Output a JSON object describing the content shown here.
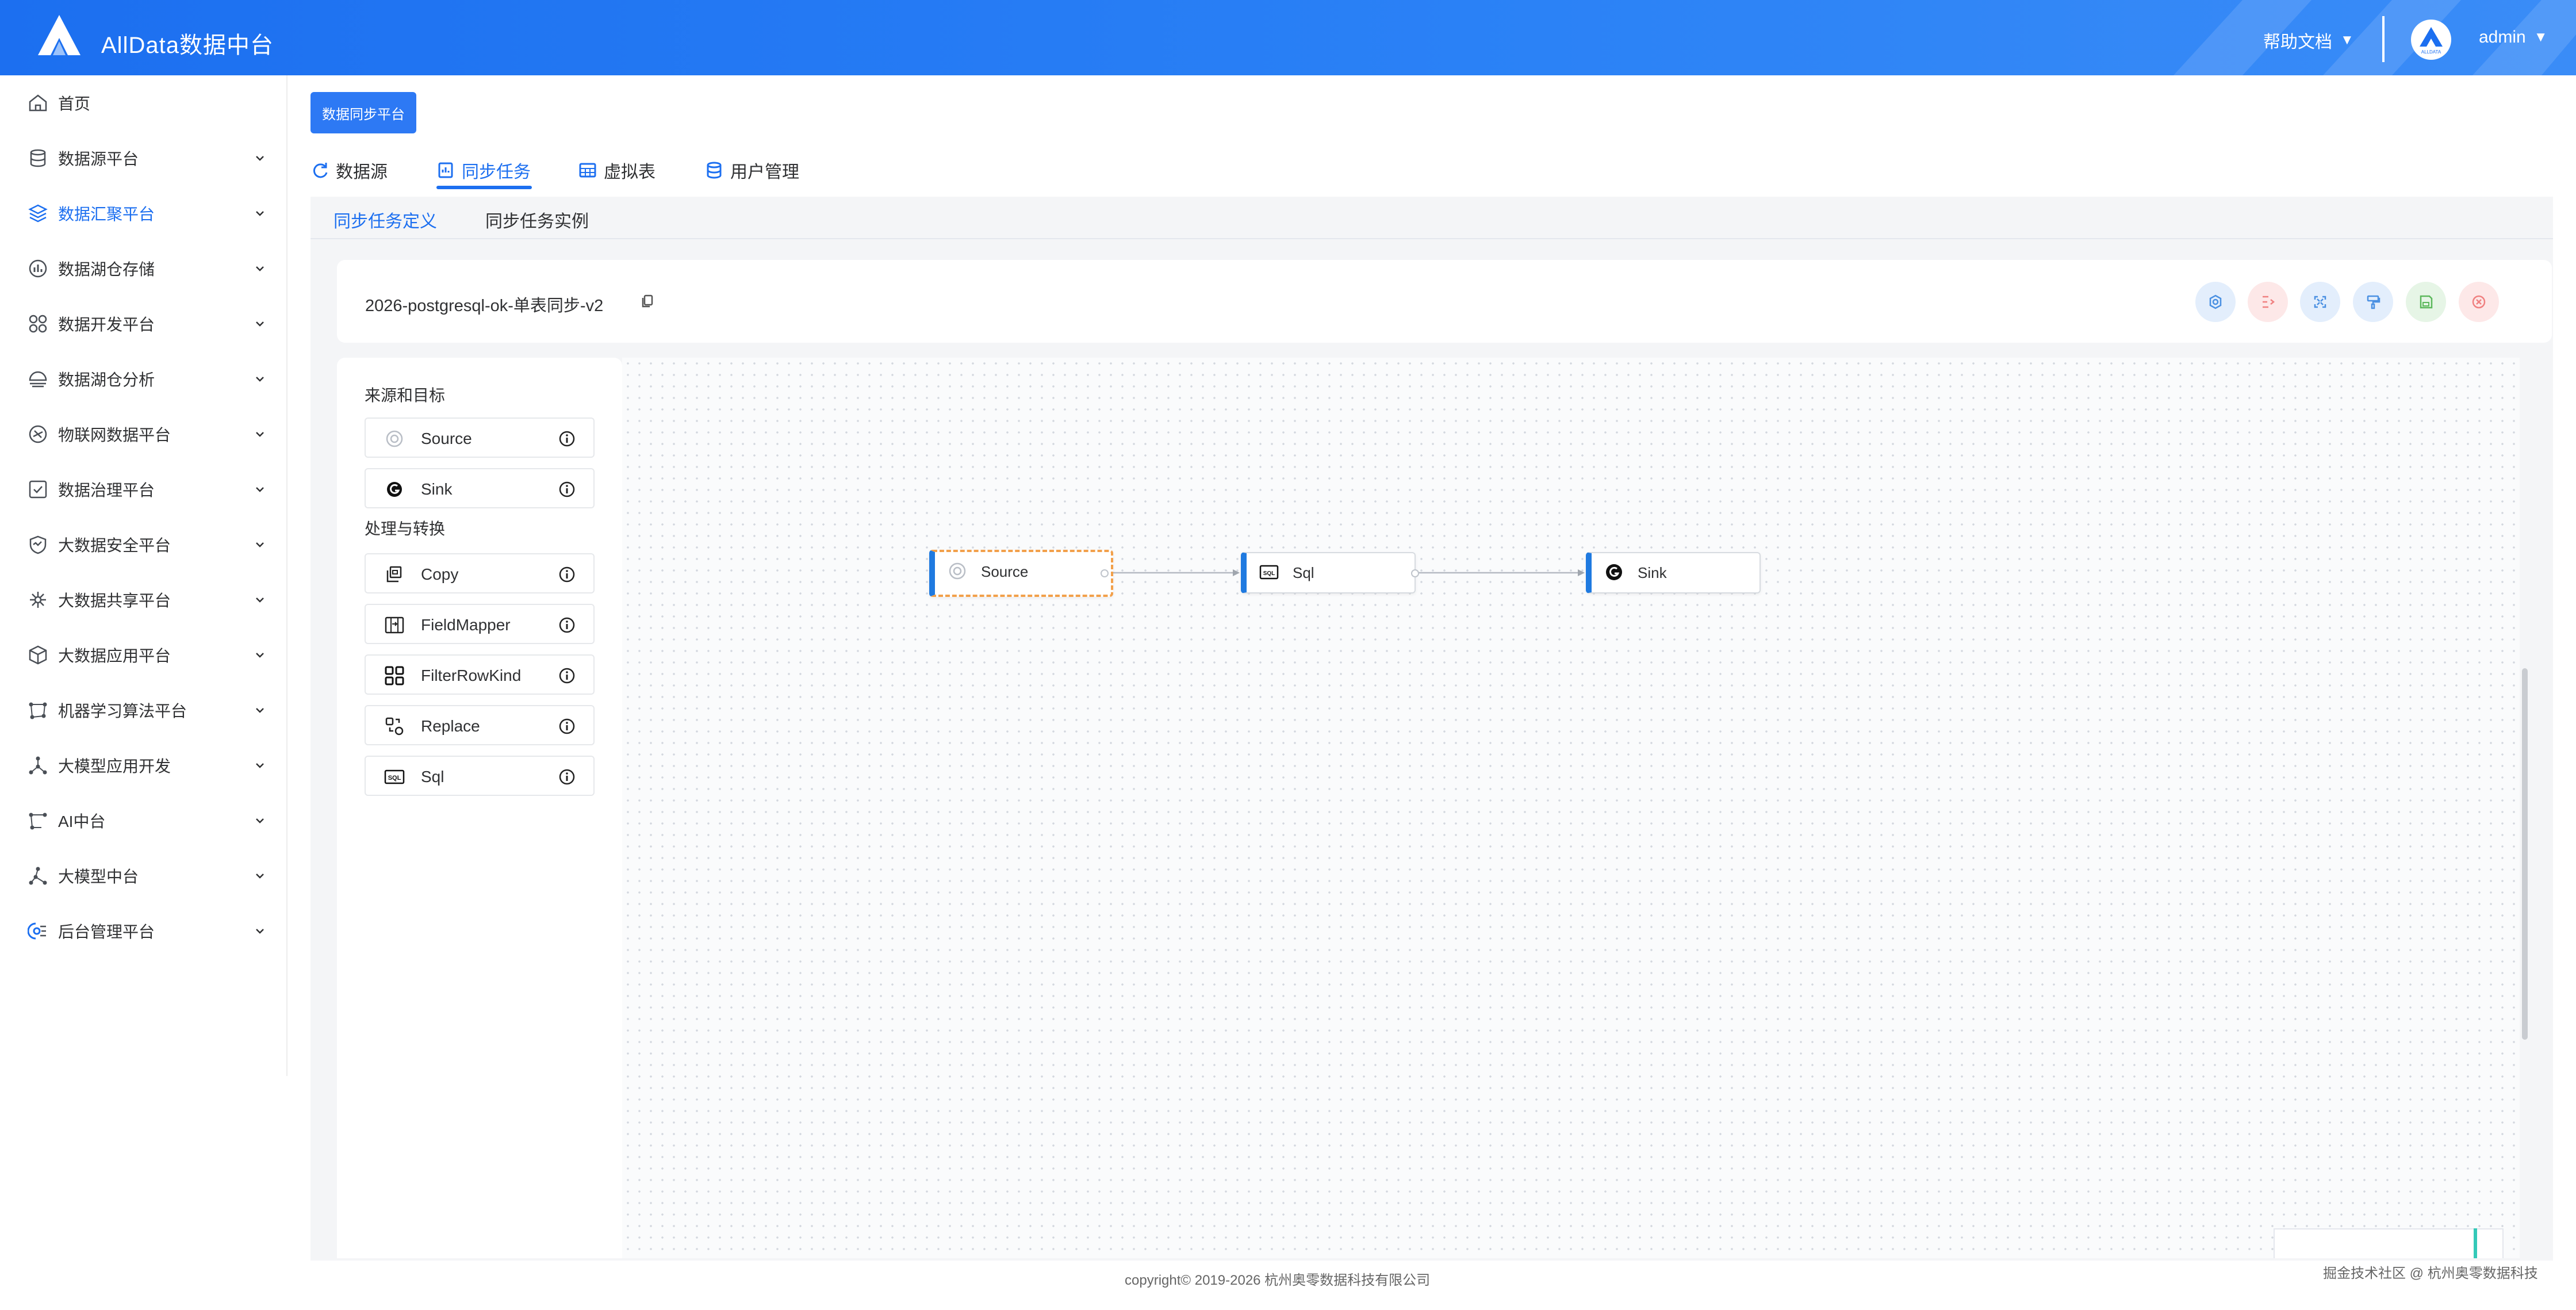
{
  "header": {
    "title": "AllData数据中台",
    "help_label": "帮助文档",
    "user_name": "admin",
    "avatar_text": "ALLDATA",
    "brand_color": "#1c6ff0"
  },
  "sidebar": {
    "items": [
      {
        "label": "首页",
        "icon": "home-icon",
        "has_arrow": false,
        "active": false
      },
      {
        "label": "数据源平台",
        "icon": "database-icon",
        "has_arrow": true,
        "active": false
      },
      {
        "label": "数据汇聚平台",
        "icon": "layers-icon",
        "has_arrow": true,
        "active": true
      },
      {
        "label": "数据湖仓存储",
        "icon": "bar-chart-icon",
        "has_arrow": true,
        "active": false
      },
      {
        "label": "数据开发平台",
        "icon": "grid-icon",
        "has_arrow": true,
        "active": false
      },
      {
        "label": "数据湖仓分析",
        "icon": "analysis-icon",
        "has_arrow": true,
        "active": false
      },
      {
        "label": "物联网数据平台",
        "icon": "link-icon",
        "has_arrow": true,
        "active": false
      },
      {
        "label": "数据治理平台",
        "icon": "checkbox-icon",
        "has_arrow": true,
        "active": false
      },
      {
        "label": "大数据安全平台",
        "icon": "shield-icon",
        "has_arrow": true,
        "active": false
      },
      {
        "label": "大数据共享平台",
        "icon": "share-icon",
        "has_arrow": true,
        "active": false
      },
      {
        "label": "大数据应用平台",
        "icon": "cube-icon",
        "has_arrow": true,
        "active": false
      },
      {
        "label": "机器学习算法平台",
        "icon": "nodes-icon",
        "has_arrow": true,
        "active": false
      },
      {
        "label": "大模型应用开发",
        "icon": "network-icon",
        "has_arrow": true,
        "active": false
      },
      {
        "label": "AI中台",
        "icon": "ai-icon",
        "has_arrow": true,
        "active": false
      },
      {
        "label": "大模型中台",
        "icon": "model-icon",
        "has_arrow": true,
        "active": false
      },
      {
        "label": "后台管理平台",
        "icon": "settings-icon",
        "has_arrow": true,
        "active": false
      }
    ]
  },
  "platform_button": "数据同步平台",
  "tabs": [
    {
      "label": "数据源",
      "icon": "refresh-icon",
      "active": false
    },
    {
      "label": "同步任务",
      "icon": "task-icon",
      "active": true
    },
    {
      "label": "虚拟表",
      "icon": "table-icon",
      "active": false
    },
    {
      "label": "用户管理",
      "icon": "database-icon",
      "active": false
    }
  ],
  "sub_tabs": [
    {
      "label": "同步任务定义",
      "active": true
    },
    {
      "label": "同步任务实例",
      "active": false
    }
  ],
  "task": {
    "name": "2026-postgresql-ok-单表同步-v2"
  },
  "toolbar": [
    {
      "name": "settings-button",
      "icon": "gear-icon",
      "color": "#4a90e2",
      "bg": "#e3eefc"
    },
    {
      "name": "arrange-button",
      "icon": "arrange-icon",
      "color": "#f08080",
      "bg": "#fde8e8"
    },
    {
      "name": "fit-view-button",
      "icon": "fit-icon",
      "color": "#4a90e2",
      "bg": "#e3eefc"
    },
    {
      "name": "format-button",
      "icon": "paint-icon",
      "color": "#4a90e2",
      "bg": "#e3eefc"
    },
    {
      "name": "save-button",
      "icon": "save-icon",
      "color": "#5cb85c",
      "bg": "#e6f5e6"
    },
    {
      "name": "close-button",
      "icon": "close-icon",
      "color": "#f08080",
      "bg": "#fde8e8"
    }
  ],
  "palette": {
    "groups": [
      {
        "title": "来源和目标",
        "items": [
          {
            "label": "Source",
            "icon": "source-icon"
          },
          {
            "label": "Sink",
            "icon": "sink-icon"
          }
        ]
      },
      {
        "title": "处理与转换",
        "items": [
          {
            "label": "Copy",
            "icon": "copy-icon"
          },
          {
            "label": "FieldMapper",
            "icon": "field-mapper-icon"
          },
          {
            "label": "FilterRowKind",
            "icon": "filter-icon"
          },
          {
            "label": "Replace",
            "icon": "replace-icon"
          },
          {
            "label": "Sql",
            "icon": "sql-icon"
          }
        ]
      }
    ]
  },
  "flow": {
    "nodes": [
      {
        "label": "Source",
        "icon": "source-icon",
        "selected": true
      },
      {
        "label": "Sql",
        "icon": "sql-icon",
        "selected": false
      },
      {
        "label": "Sink",
        "icon": "sink-icon",
        "selected": false
      }
    ]
  },
  "footer": {
    "copyright": "copyright© 2019-2026 杭州奥零数据科技有限公司",
    "watermark": "掘金技术社区 @ 杭州奥零数据科技"
  }
}
